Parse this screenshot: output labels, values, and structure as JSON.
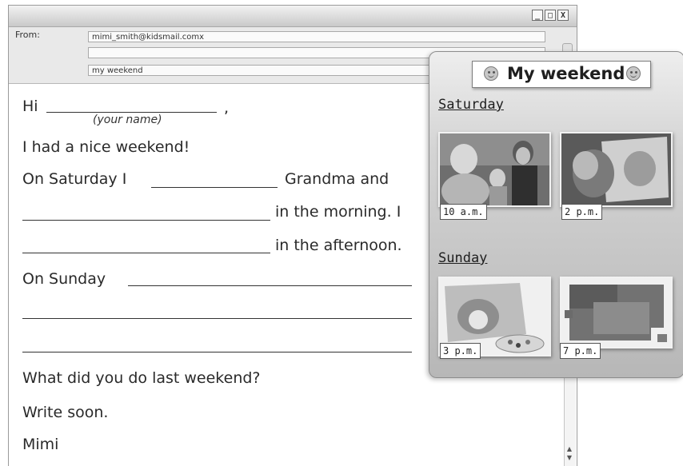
{
  "window": {
    "controls": {
      "minimize": "_",
      "maximize": "□",
      "close": "X"
    }
  },
  "header": {
    "from_label": "From:",
    "from_value": "mimi_smith@kidsmail.comx",
    "to_value": "",
    "subject_value": "my weekend"
  },
  "letter": {
    "greeting": "Hi",
    "greeting_comma": ",",
    "name_hint": "(your name)",
    "line1": "I had a nice weekend!",
    "sat_prefix": "On Saturday I",
    "sat_suffix": "Grandma and",
    "morning_suffix": "in the morning. I",
    "afternoon_suffix": "in the afternoon.",
    "sun_prefix": "On Sunday",
    "question": "What did you do last weekend?",
    "closing": "Write soon.",
    "signature": "Mimi"
  },
  "panel": {
    "title": "My weekend",
    "saturday_label": "Saturday",
    "sunday_label": "Sunday",
    "photos": [
      {
        "time": "10 a.m.",
        "icon": "family-photo"
      },
      {
        "time": "2 p.m.",
        "icon": "album-photo"
      },
      {
        "time": "3 p.m.",
        "icon": "painting-photo"
      },
      {
        "time": "7 p.m.",
        "icon": "puzzle-photo"
      }
    ]
  },
  "scrollbar": {
    "up": "▲",
    "down": "▼"
  },
  "colors": {
    "panel_dark": "#b7b7b7",
    "panel_light": "#eeeeee",
    "text": "#2a2a2a"
  }
}
